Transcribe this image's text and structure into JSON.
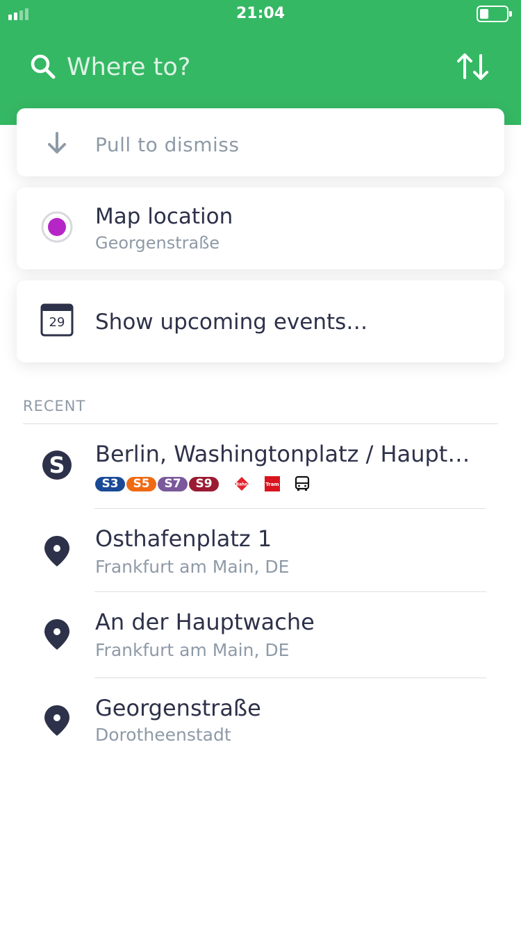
{
  "status_bar": {
    "time": "21:04"
  },
  "search": {
    "placeholder": "Where to?"
  },
  "quick_cards": {
    "dismiss": {
      "label": "Pull to dismiss"
    },
    "map_location": {
      "title": "Map location",
      "subtitle": "Georgenstraße"
    },
    "events": {
      "title": "Show upcoming events…",
      "calendar_day": "29"
    }
  },
  "recent": {
    "section_label": "RECENT",
    "items": [
      {
        "title": "Berlin, Washingtonplatz / Haupt…",
        "icon": "s-bahn-icon",
        "lines": [
          {
            "label": "S3",
            "color": "#1a4a96"
          },
          {
            "label": "S5",
            "color": "#ef6a13"
          },
          {
            "label": "S7",
            "color": "#7a589b"
          },
          {
            "label": "S9",
            "color": "#9b1b32"
          }
        ],
        "modes": [
          "bahn-icon",
          "tram-icon",
          "bus-icon"
        ],
        "mode_labels": {
          "bahn": "Bahn",
          "tram": "Tram"
        }
      },
      {
        "title": "Osthafenplatz 1",
        "subtitle": "Frankfurt am Main, DE",
        "icon": "location-pin-icon"
      },
      {
        "title": "An der Hauptwache",
        "subtitle": "Frankfurt am Main, DE",
        "icon": "location-pin-icon"
      },
      {
        "title": "Georgenstraße",
        "subtitle": "Dorotheenstadt",
        "icon": "location-pin-icon"
      }
    ]
  },
  "colors": {
    "brand_green": "#35b864",
    "text_dark": "#2d3149",
    "text_muted": "#8e9aa7",
    "map_dot": "#b626c7"
  }
}
